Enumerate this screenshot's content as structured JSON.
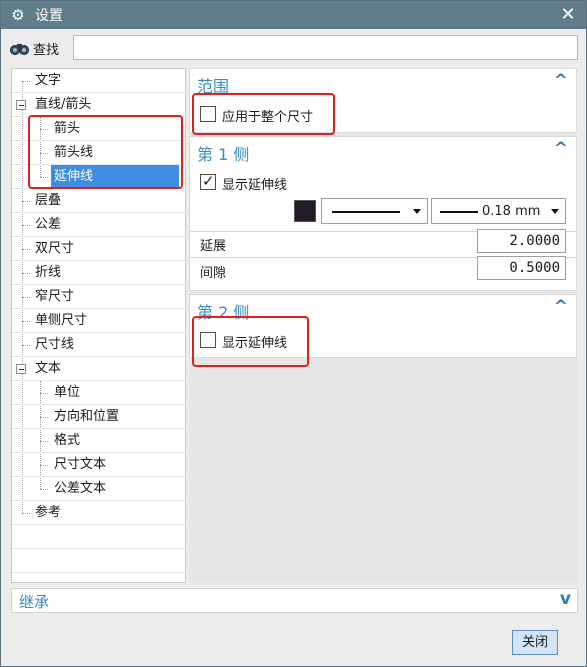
{
  "window": {
    "title": "设置",
    "close_glyph": "✕"
  },
  "search": {
    "label": "查找",
    "value": "",
    "placeholder": ""
  },
  "tree": {
    "items": [
      {
        "label": "文字"
      },
      {
        "label": "直线/箭头"
      },
      {
        "label": "箭头"
      },
      {
        "label": "箭头线"
      },
      {
        "label": "延伸线"
      },
      {
        "label": "层叠"
      },
      {
        "label": "公差"
      },
      {
        "label": "双尺寸"
      },
      {
        "label": "折线"
      },
      {
        "label": "窄尺寸"
      },
      {
        "label": "单侧尺寸"
      },
      {
        "label": "尺寸线"
      },
      {
        "label": "文本"
      },
      {
        "label": "单位"
      },
      {
        "label": "方向和位置"
      },
      {
        "label": "格式"
      },
      {
        "label": "尺寸文本"
      },
      {
        "label": "公差文本"
      },
      {
        "label": "参考"
      }
    ],
    "selected": "延伸线"
  },
  "sections": {
    "scope": {
      "title": "范围",
      "checkbox_label": "应用于整个尺寸",
      "checked": false
    },
    "side1": {
      "title": "第 1 侧",
      "checkbox_label": "显示延伸线",
      "checked": true,
      "line_width": "0.18 mm",
      "extension_label": "延展",
      "extension_value": "2.0000",
      "gap_label": "间隙",
      "gap_value": "0.5000"
    },
    "side2": {
      "title": "第 2 侧",
      "checkbox_label": "显示延伸线",
      "checked": false
    }
  },
  "inherit": {
    "title": "继承"
  },
  "buttons": {
    "close": "关闭"
  },
  "colors": {
    "title_bar": "#5f7d8a",
    "accent": "#3a8ac0",
    "selection": "#3f8de0",
    "highlight": "#e02020",
    "swatch": "#231a28"
  }
}
